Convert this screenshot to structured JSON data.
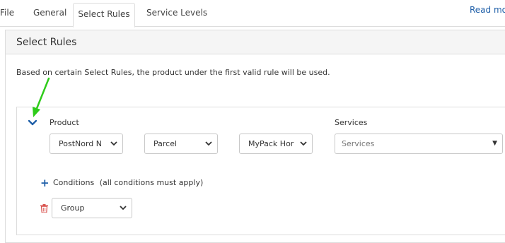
{
  "tabs": [
    {
      "label": "File"
    },
    {
      "label": "General"
    },
    {
      "label": "Select Rules",
      "active": true
    },
    {
      "label": "Service Levels"
    }
  ],
  "read_more": "Read more",
  "panel": {
    "title": "Select Rules",
    "description": "Based on certain Select Rules, the product under the first valid rule will be used."
  },
  "rule": {
    "product_label": "Product",
    "services_label": "Services",
    "product_select": "PostNord N",
    "type_select": "Parcel",
    "service_select": "MyPack Hor",
    "services_placeholder": "Services",
    "conditions_label": "Conditions",
    "conditions_note": "(all conditions must apply)",
    "group_select": "Group"
  },
  "colors": {
    "accent": "#1f5fa8",
    "annotation_arrow": "#2ecc1a",
    "trash": "#d9534f"
  },
  "icons": {
    "collapse": "chevron-down-icon",
    "add": "plus-icon",
    "delete": "trash-icon",
    "dropdown": "chevron-down-icon"
  }
}
